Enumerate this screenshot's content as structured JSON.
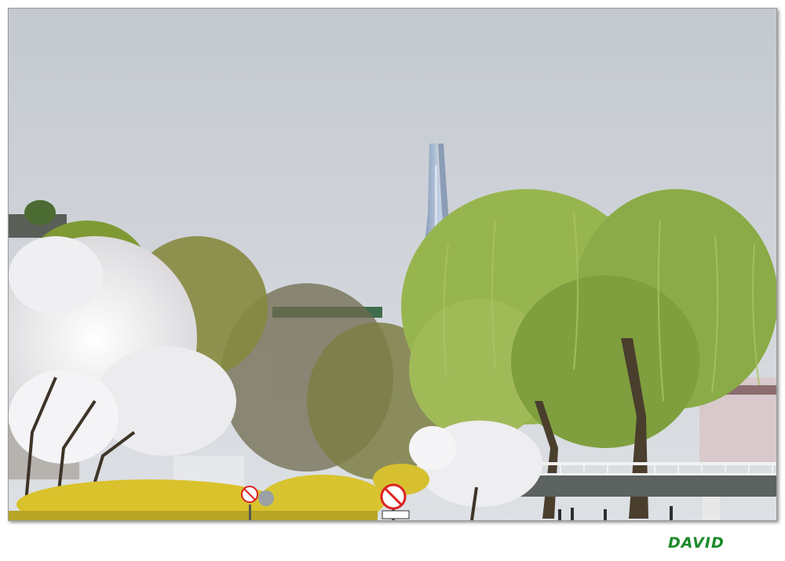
{
  "photo": {
    "caption": "",
    "signature": "DAVID",
    "signature_color": "#1c8a2a",
    "palette": {
      "sky_top": "#c6cbd1",
      "sky_bottom": "#dadde2",
      "tower": "#9fb4cf",
      "willow": "#8fb04a",
      "blossom": "#f3f2f4",
      "forsythia": "#e0c828",
      "bridge_rail": "#f0f0f0"
    },
    "scene": [
      {
        "id": "sky",
        "icon": "sky-background"
      },
      {
        "id": "skyscraper",
        "icon": "supertall-tower-icon"
      },
      {
        "id": "willow-trees",
        "icon": "willow-tree-icon"
      },
      {
        "id": "cherry-blossoms",
        "icon": "cherry-blossom-tree-icon"
      },
      {
        "id": "forsythia-bushes",
        "icon": "yellow-shrub-icon"
      },
      {
        "id": "bridge",
        "icon": "bridge-railing-icon"
      },
      {
        "id": "no-bicycle-signs",
        "icon": "no-bicycle-sign-icon"
      }
    ]
  }
}
